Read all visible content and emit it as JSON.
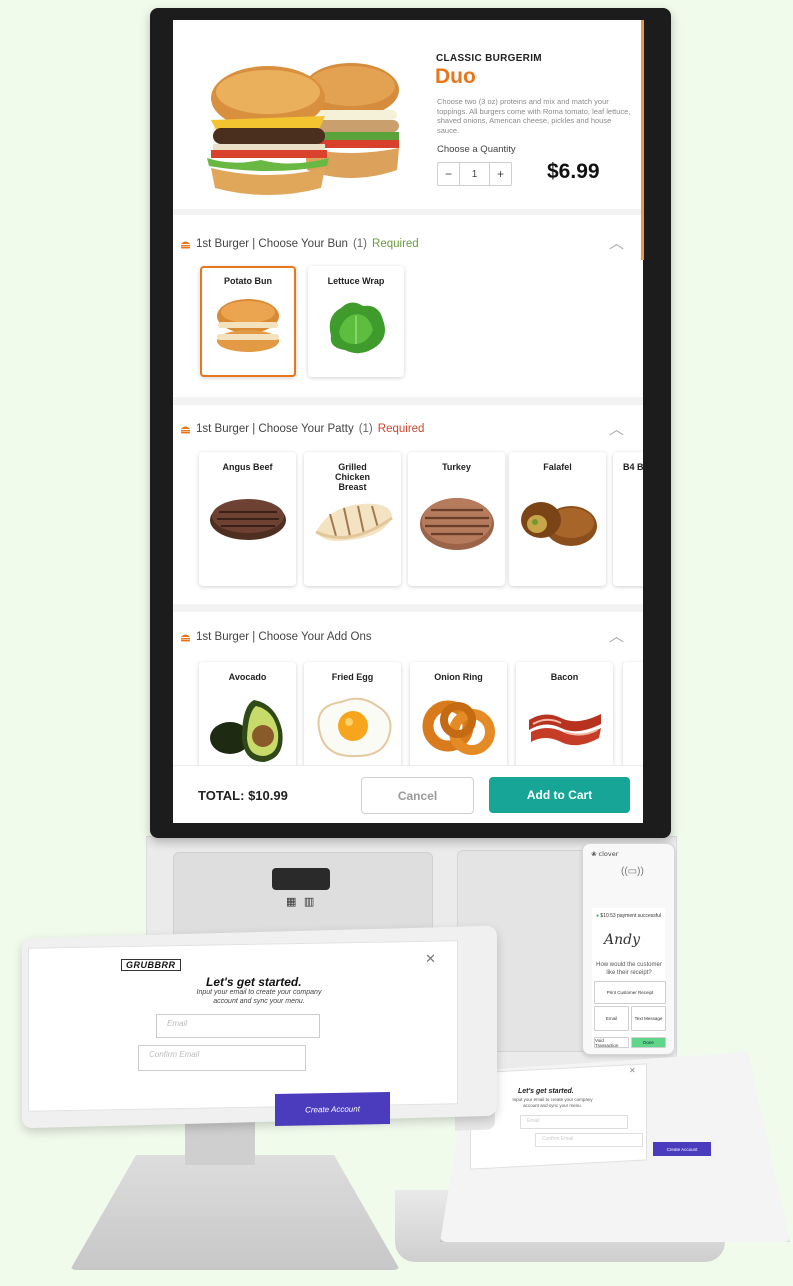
{
  "product": {
    "brand": "CLASSIC BURGERIM",
    "name": "Duo",
    "description": "Choose two (3 oz) proteins and mix and match your toppings. All burgers come with Roma tomato, leaf lettuce, shaved onions, American cheese, pickles and house sauce.",
    "quantity_label": "Choose a Quantity",
    "quantity": "1",
    "price": "$6.99",
    "minus": "−",
    "plus": "+"
  },
  "sections": [
    {
      "title": "1st Burger | Choose Your Bun",
      "count": "(1)",
      "required": "Required",
      "options": [
        "Potato Bun",
        "Lettuce Wrap"
      ]
    },
    {
      "title": "1st Burger | Choose Your Patty",
      "count": "(1)",
      "required": "Required",
      "options": [
        "Angus Beef",
        "Grilled Chicken Breast",
        "Turkey",
        "Falafel",
        "B4 B"
      ]
    },
    {
      "title": "1st Burger | Choose Your Add Ons",
      "options": [
        "Avocado",
        "Fried Egg",
        "Onion Ring",
        "Bacon"
      ]
    }
  ],
  "footer": {
    "total": "TOTAL: $10.99",
    "cancel": "Cancel",
    "add_to_cart": "Add to Cart"
  },
  "clover": {
    "logo": "clover",
    "success": "$10.53 payment successful",
    "question": "How would the customer like their receipt?",
    "print": "Print Customer Receipt",
    "email": "Email",
    "text": "Text Message",
    "void": "Void Transaction",
    "done": "Done"
  },
  "tablet_left": {
    "logo": "GRUBBRR",
    "title": "Let's get started.",
    "subtitle": "Input your email to create your company account and sync your menu.",
    "email_placeholder": "Email",
    "confirm_placeholder": "Confirm Email",
    "create": "Create Account"
  },
  "tablet_right": {
    "title": "Let's get started.",
    "subtitle": "Input your email to create your company account and sync your menu.",
    "email_placeholder": "Email",
    "confirm_placeholder": "Confirm Email",
    "create": "Create Account"
  },
  "colors": {
    "accent_orange": "#e8761a",
    "teal": "#16a596",
    "required_green": "#6a9c3f",
    "required_red": "#c9482f",
    "create_purple": "#4b3bbd"
  }
}
